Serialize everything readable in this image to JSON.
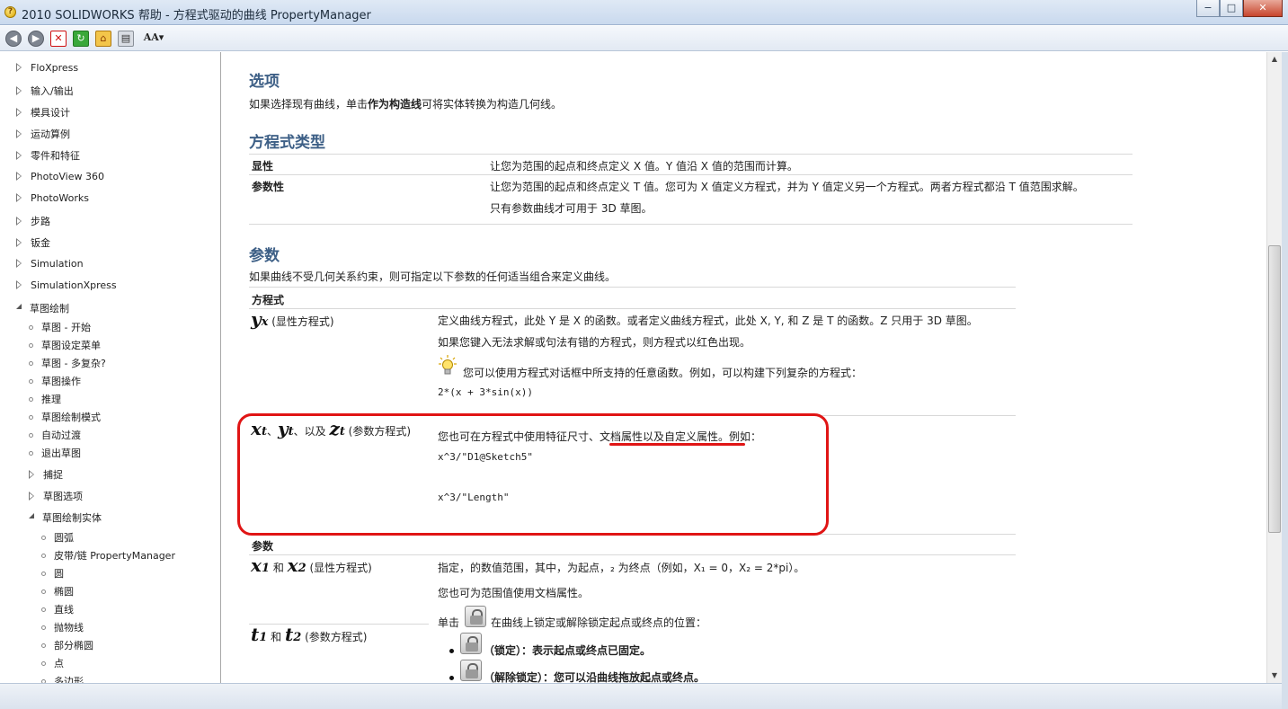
{
  "window": {
    "title": "2010 SOLIDWORKS 帮助 - 方程式驱动的曲线 PropertyManager",
    "minimize": "−",
    "maximize": "□",
    "close": "✕"
  },
  "toolbar": {
    "back_icon": "◀",
    "forward_icon": "▶",
    "stop_icon": "✕",
    "refresh_icon": "↻",
    "home_icon": "⌂",
    "print_icon": "▤",
    "font_icon": "AA▾"
  },
  "sidebar": {
    "items": [
      {
        "label": "FloXpress",
        "type": "closed"
      },
      {
        "label": "输入/输出",
        "type": "closed"
      },
      {
        "label": "模具设计",
        "type": "closed"
      },
      {
        "label": "运动算例",
        "type": "closed"
      },
      {
        "label": "零件和特征",
        "type": "closed"
      },
      {
        "label": "PhotoView 360",
        "type": "closed"
      },
      {
        "label": "PhotoWorks",
        "type": "closed"
      },
      {
        "label": "步路",
        "type": "closed"
      },
      {
        "label": "钣金",
        "type": "closed"
      },
      {
        "label": "Simulation",
        "type": "closed"
      },
      {
        "label": "SimulationXpress",
        "type": "closed"
      },
      {
        "label": "草图绘制",
        "type": "open"
      },
      {
        "label": "草图 - 开始",
        "type": "leaf"
      },
      {
        "label": "草图设定菜单",
        "type": "leaf"
      },
      {
        "label": "草图 - 多复杂?",
        "type": "leaf"
      },
      {
        "label": "草图操作",
        "type": "leaf"
      },
      {
        "label": "推理",
        "type": "leaf"
      },
      {
        "label": "草图绘制模式",
        "type": "leaf"
      },
      {
        "label": "自动过渡",
        "type": "leaf"
      },
      {
        "label": "退出草图",
        "type": "leaf"
      },
      {
        "label": "捕捉",
        "type": "closed"
      },
      {
        "label": "草图选项",
        "type": "closed"
      },
      {
        "label": "草图绘制实体",
        "type": "open"
      },
      {
        "label": "圆弧",
        "type": "leaf2"
      },
      {
        "label": "皮带/链 PropertyManager",
        "type": "leaf2"
      },
      {
        "label": "圆",
        "type": "leaf2"
      },
      {
        "label": "椭圆",
        "type": "leaf2"
      },
      {
        "label": "直线",
        "type": "leaf2"
      },
      {
        "label": "抛物线",
        "type": "leaf2"
      },
      {
        "label": "部分椭圆",
        "type": "leaf2"
      },
      {
        "label": "点",
        "type": "leaf2"
      },
      {
        "label": "多边形",
        "type": "leaf2"
      }
    ]
  },
  "content": {
    "options": {
      "heading": "选项",
      "text_before": "如果选择现有曲线，单击",
      "text_bold": "作为构造线",
      "text_after": "可将实体转换为构造几何线。"
    },
    "eqtype": {
      "heading": "方程式类型",
      "rows": [
        {
          "term": "显性",
          "desc": "让您为范围的起点和终点定义 X 值。Y 值沿 X 值的范围而计算。"
        },
        {
          "term": "参数性",
          "desc": "让您为范围的起点和终点定义 T 值。您可为 X 值定义方程式，并为 Y 值定义另一个方程式。两者方程式都沿 T 值范围求解。",
          "desc2": "只有参数曲线才可用于 3D 草图。"
        }
      ]
    },
    "params": {
      "heading": "参数",
      "intro": "如果曲线不受几何关系约束，则可指定以下参数的任何适当组合来定义曲线。",
      "equation_label": "方程式",
      "yx": {
        "sym": "y",
        "sub": "x",
        "label": "(显性方程式)"
      },
      "yx_desc1": "定义曲线方程式，此处 Y 是 X 的函数。或者定义曲线方程式，此处 X, Y, 和 Z 是 T 的函数。Z 只用于 3D 草图。",
      "yx_desc2": "如果您键入无法求解或句法有错的方程式，则方程式以红色出现。",
      "tip": "您可以使用方程式对话框中所支持的任意函数。例如，可以构建下列复杂的方程式：",
      "code1": "2*(x + 3*sin(x))",
      "xt": {
        "x": "x",
        "y": "y",
        "z": "z",
        "t": "t",
        "sep": "、",
        "and": "以及",
        "label": "(参数方程式)"
      },
      "xt_desc_before": "您也可在方程式中使用特征尺寸、",
      "xt_desc_link": "文档属性以及自定义属性",
      "xt_desc_after": "。例如：",
      "code2": "x^3/\"D1@Sketch5\"",
      "code3": "x^3/\"Length\"",
      "param_label": "参数",
      "x12": {
        "sym": "x",
        "s1": "1",
        "s2": "2",
        "and": "和",
        "label": "(显性方程式)"
      },
      "x12_desc": "指定，的数值范围，其中，为起点，₂ 为终点（例如，X₁ = 0，X₂ = 2*pi）。",
      "x12_desc2": "您也可为范围值使用文档属性。",
      "click_before": "单击",
      "click_after": "在曲线上锁定或解除锁定起点或终点的位置：",
      "lock": "（锁定）：表示起点或终点已固定。",
      "unlock": "（解除锁定）：您可以沿曲线拖放起点或终点。",
      "t12": {
        "sym": "t",
        "s1": "1",
        "s2": "2",
        "and": "和",
        "label": "(参数方程式)"
      }
    }
  },
  "colors": {
    "heading": "#3d5f86",
    "annotation": "#e01515"
  }
}
